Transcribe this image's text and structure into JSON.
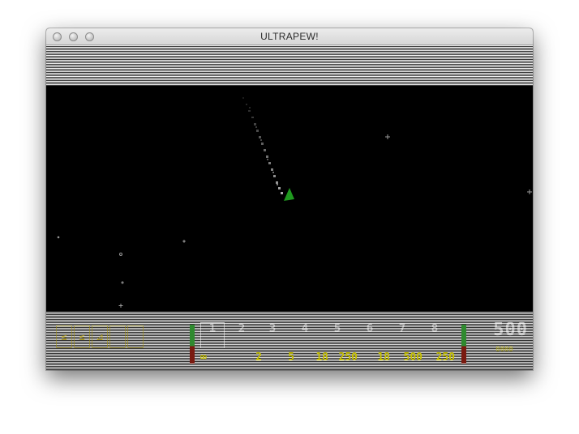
{
  "window": {
    "title": "ULTRAPEW!"
  },
  "hud": {
    "controls": [
      "≤",
      "≤",
      "⊿"
    ],
    "weapon_slots": [
      "1",
      "2",
      "3",
      "4",
      "5",
      "6",
      "7",
      "8"
    ],
    "selected_slot": 1,
    "ammo": [
      "∞",
      "2",
      "5",
      "18",
      "250",
      "18",
      "500",
      "250"
    ],
    "score": "500",
    "score_sub": "0000"
  },
  "colors": {
    "ship": "#1f9a1f",
    "trail": "#bdbdbd",
    "ammo_text": "#c8c200",
    "meter_green": "#2f8a2f",
    "meter_red": "#7a1a10"
  },
  "icons": {
    "player_ship": "green-triangle-ship",
    "enemies": "plus-star-sprite"
  }
}
